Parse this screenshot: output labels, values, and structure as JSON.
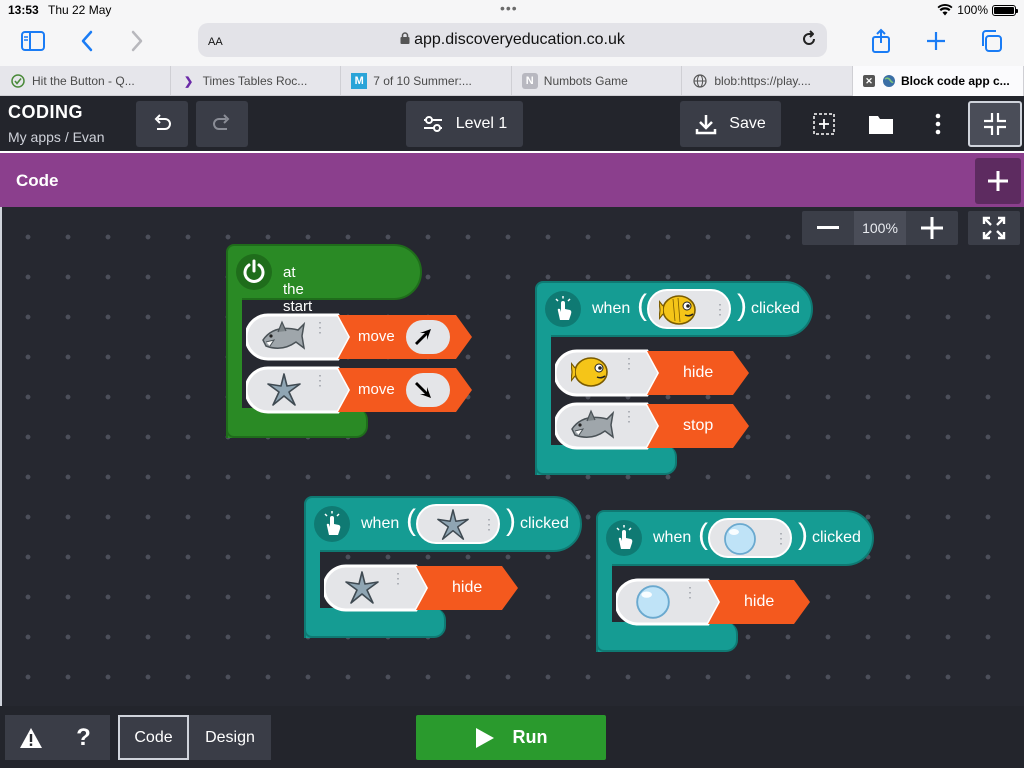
{
  "status_bar": {
    "time": "13:53",
    "date": "Thu 22 May",
    "battery": "100%"
  },
  "browser": {
    "text_size_label": "AA",
    "url": "app.discoveryeducation.co.uk",
    "tabs": [
      {
        "label": "Hit the Button - Q...",
        "icon": "check-circle-icon"
      },
      {
        "label": "Times Tables Roc...",
        "icon": "ttrs-icon"
      },
      {
        "label": "7 of 10 Summer:...",
        "icon": "m-icon"
      },
      {
        "label": "Numbots Game",
        "icon": "n-icon"
      },
      {
        "label": "blob:https://play....",
        "icon": "globe-icon"
      },
      {
        "label": "Block code app c...",
        "icon": "globe-icon",
        "active": true
      }
    ]
  },
  "app": {
    "title": "CODING",
    "breadcrumb_root": "My apps",
    "breadcrumb_sep": "/",
    "breadcrumb_current": "Evan",
    "level_label": "Level 1",
    "save_label": "Save"
  },
  "code_bar": {
    "label": "Code"
  },
  "zoom": {
    "level": "100%"
  },
  "blocks": {
    "start": {
      "label": "at the start",
      "rows": [
        {
          "sprite": "shark",
          "command": "move",
          "direction": "up-right"
        },
        {
          "sprite": "starfish",
          "command": "move",
          "direction": "down-right"
        }
      ]
    },
    "fish_event": {
      "when": "when",
      "sprite": "fish",
      "clicked": "clicked",
      "rows": [
        {
          "sprite": "fish",
          "command": "hide"
        },
        {
          "sprite": "shark",
          "command": "stop"
        }
      ]
    },
    "star_event": {
      "when": "when",
      "sprite": "starfish",
      "clicked": "clicked",
      "rows": [
        {
          "sprite": "starfish",
          "command": "hide"
        }
      ]
    },
    "bubble_event": {
      "when": "when",
      "sprite": "bubble",
      "clicked": "clicked",
      "rows": [
        {
          "sprite": "bubble",
          "command": "hide"
        }
      ]
    }
  },
  "colors": {
    "start_green": "#2a8a25",
    "event_teal": "#159c93",
    "command_orange": "#f4591e",
    "header_dark": "#23252c",
    "code_purple": "#8b3f8d",
    "run_green": "#2a9a2d"
  },
  "bottom": {
    "code_tab": "Code",
    "design_tab": "Design",
    "run_label": "Run"
  }
}
